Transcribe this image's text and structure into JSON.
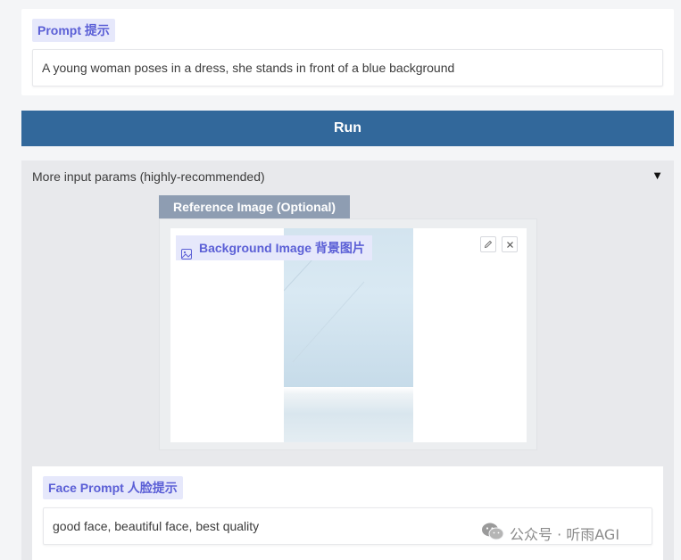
{
  "prompt": {
    "label": "Prompt 提示",
    "value": "A young woman poses in a dress, she stands in front of a blue background"
  },
  "run_button": {
    "label": "Run"
  },
  "more_params": {
    "title": "More input params (highly-recommended)",
    "toggle": "▼",
    "reference_image": {
      "label": "Reference Image (Optional)",
      "image_label": "Background Image 背景图片",
      "icon": "image-icon",
      "edit_icon": "pencil-icon",
      "clear_icon": "close-icon"
    },
    "face_prompt": {
      "label": "Face Prompt 人脸提示",
      "value": "good face, beautiful face, best quality"
    }
  },
  "watermark": {
    "text": "公众号 · 听雨AGI",
    "icon": "wechat-icon"
  },
  "colors": {
    "accent": "#5b5fd6",
    "badge_bg": "#e6e8fb",
    "run_button": "#32689b",
    "reference_label_bg": "#8e9db2"
  }
}
